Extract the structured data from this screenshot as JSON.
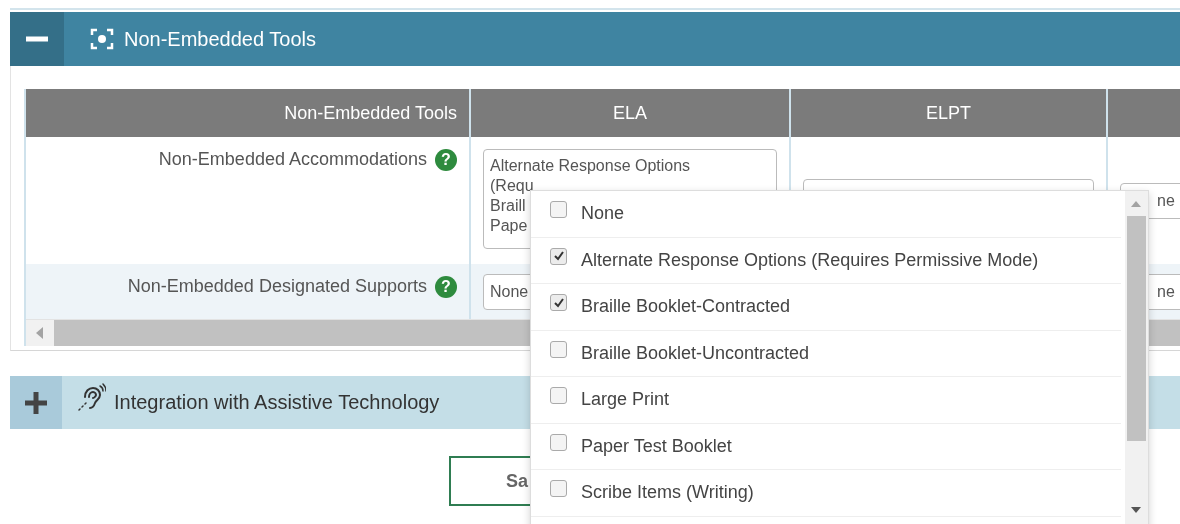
{
  "tools_panel": {
    "title": "Non-Embedded Tools",
    "expanded": true,
    "table": {
      "columns": [
        "Non-Embedded Tools",
        "ELA",
        "ELPT"
      ],
      "rows": [
        {
          "label": "Non-Embedded Accommodations",
          "help": "?",
          "cells": [
            {
              "kind": "multi",
              "lines": [
                "Alternate Response Options",
                "(Requ",
                "Braill",
                "Pape"
              ]
            },
            {
              "kind": "blank"
            },
            {
              "kind": "single",
              "value": "ne"
            }
          ]
        },
        {
          "label": "Non-Embedded Designated Supports",
          "help": "?",
          "cells": [
            {
              "kind": "single",
              "value": "None"
            },
            {
              "kind": "hidden"
            },
            {
              "kind": "single",
              "value": "ne"
            }
          ]
        }
      ]
    }
  },
  "assistive_panel": {
    "title": "Integration with Assistive Technology",
    "expanded": false
  },
  "save_button": "Sa",
  "dropdown": {
    "options": [
      {
        "label": "None",
        "checked": false
      },
      {
        "label": "Alternate Response Options (Requires Permissive Mode)",
        "checked": true
      },
      {
        "label": "Braille Booklet-Contracted",
        "checked": true
      },
      {
        "label": "Braille Booklet-Uncontracted",
        "checked": false
      },
      {
        "label": "Large Print",
        "checked": false
      },
      {
        "label": "Paper Test Booklet",
        "checked": false
      },
      {
        "label": "Scribe Items (Writing)",
        "checked": false
      }
    ]
  }
}
